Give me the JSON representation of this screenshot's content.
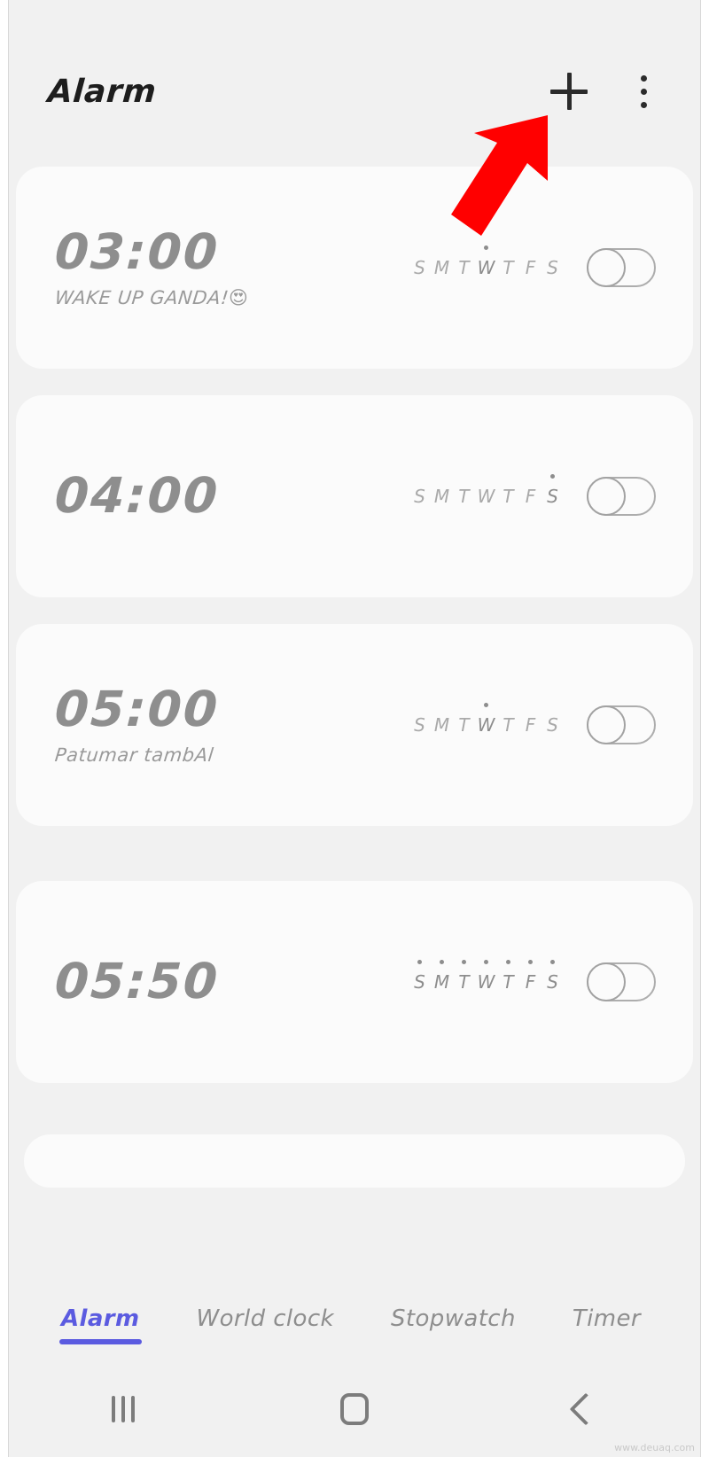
{
  "app": {
    "title": "Alarm",
    "accent_color": "#5B5BE0",
    "background_color": "#F1F1F1",
    "card_color": "#FBFBFB",
    "text_color": "#8E8E8E"
  },
  "header": {
    "title": "Alarm",
    "add_icon": "plus-icon",
    "more_icon": "kebab-menu-icon"
  },
  "annotation": {
    "type": "arrow",
    "color": "#FF0000",
    "points_to": "add-alarm-button"
  },
  "day_initials": [
    "S",
    "M",
    "T",
    "W",
    "T",
    "F",
    "S"
  ],
  "alarms": [
    {
      "time": "03:00",
      "label": "WAKE UP GANDA!",
      "emoji": "😍",
      "selected_days": [
        3
      ],
      "enabled": false,
      "toggle_state": "off"
    },
    {
      "time": "04:00",
      "label": "",
      "emoji": "",
      "selected_days": [
        6
      ],
      "enabled": false,
      "toggle_state": "off"
    },
    {
      "time": "05:00",
      "label": "Patumar tambAl",
      "emoji": "",
      "selected_days": [
        3
      ],
      "enabled": false,
      "toggle_state": "off"
    },
    {
      "time": "05:50",
      "label": "",
      "emoji": "",
      "selected_days": [
        0,
        1,
        2,
        3,
        4,
        5,
        6
      ],
      "enabled": false,
      "toggle_state": "off"
    }
  ],
  "tabs": [
    {
      "label": "Alarm",
      "active": true
    },
    {
      "label": "World clock",
      "active": false
    },
    {
      "label": "Stopwatch",
      "active": false
    },
    {
      "label": "Timer",
      "active": false
    }
  ],
  "navbar": {
    "recents_icon": "recents-icon",
    "home_icon": "home-icon",
    "back_icon": "back-icon"
  },
  "watermark": "www.deuaq.com"
}
